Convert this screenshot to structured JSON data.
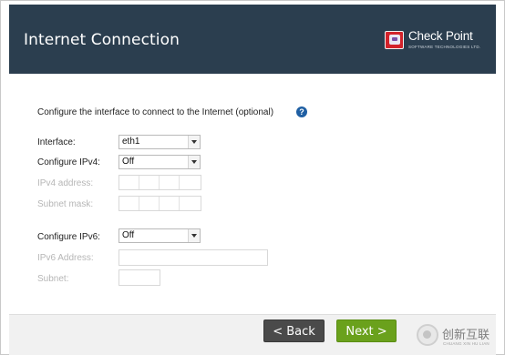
{
  "header": {
    "title": "Internet Connection",
    "brand_name": "Check Point",
    "brand_tagline": "SOFTWARE TECHNOLOGIES LTD."
  },
  "intro": "Configure the interface to connect to the Internet (optional)",
  "form": {
    "interface_label": "Interface:",
    "interface_value": "eth1",
    "ipv4_label": "Configure IPv4:",
    "ipv4_value": "Off",
    "ipv4_address_label": "IPv4 address:",
    "subnet_mask_label": "Subnet mask:",
    "ipv6_label": "Configure IPv6:",
    "ipv6_value": "Off",
    "ipv6_address_label": "IPv6 Address:",
    "subnet_label": "Subnet:"
  },
  "footer": {
    "back_label": "< Back",
    "next_label": "Next >"
  },
  "watermark": {
    "text": "创新互联",
    "subtext": "CHUANG XIN HU LIAN"
  },
  "colors": {
    "header_bg": "#2b3e4f",
    "next_button": "#6aa11c",
    "back_button": "#4a4a4a",
    "help_icon": "#1f5fa3"
  }
}
